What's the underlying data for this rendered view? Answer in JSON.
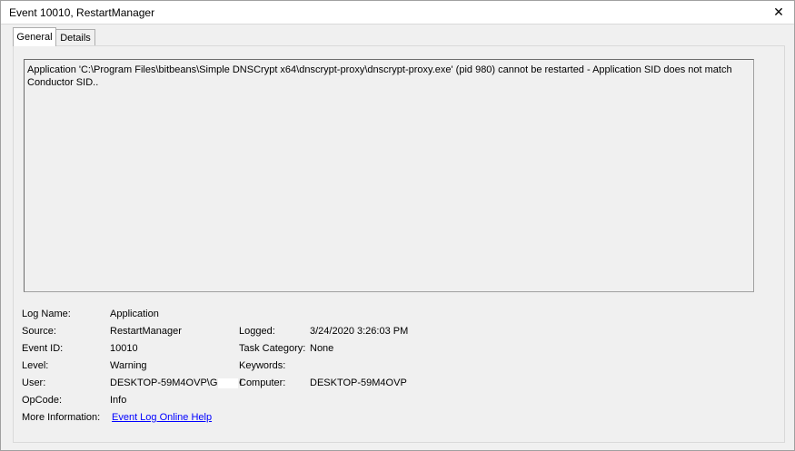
{
  "window": {
    "title": "Event 10010, RestartManager",
    "close_glyph": "✕"
  },
  "tabs": [
    {
      "label": "General",
      "active": true
    },
    {
      "label": "Details",
      "active": false
    }
  ],
  "message": "Application 'C:\\Program Files\\bitbeans\\Simple DNSCrypt x64\\dnscrypt-proxy\\dnscrypt-proxy.exe' (pid 980) cannot be restarted - Application SID does not match Conductor SID..",
  "fields": {
    "log_name": {
      "label": "Log Name:",
      "value": "Application"
    },
    "source": {
      "label": "Source:",
      "value": "RestartManager"
    },
    "logged": {
      "label": "Logged:",
      "value": "3/24/2020 3:26:03 PM"
    },
    "event_id": {
      "label": "Event ID:",
      "value": "10010"
    },
    "task_category": {
      "label": "Task Category:",
      "value": "None"
    },
    "level": {
      "label": "Level:",
      "value": "Warning"
    },
    "keywords": {
      "label": "Keywords:",
      "value": ""
    },
    "user": {
      "label": "User:",
      "value_prefix": "DESKTOP-59M4OVP\\G",
      "value_suffix": "!"
    },
    "computer": {
      "label": "Computer:",
      "value": "DESKTOP-59M4OVP"
    },
    "opcode": {
      "label": "OpCode:",
      "value": "Info"
    },
    "more_info": {
      "label": "More Information:",
      "link_text": "Event Log Online Help"
    }
  }
}
